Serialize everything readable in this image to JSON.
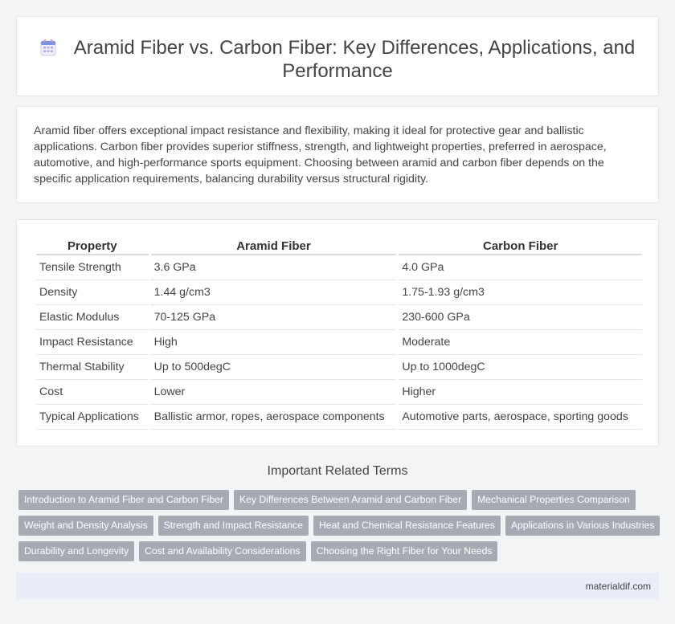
{
  "header": {
    "title": "Aramid Fiber vs. Carbon Fiber: Key Differences, Applications, and Performance",
    "icon": "calendar-icon"
  },
  "intro": {
    "text": "Aramid fiber offers exceptional impact resistance and flexibility, making it ideal for protective gear and ballistic applications. Carbon fiber provides superior stiffness, strength, and lightweight properties, preferred in aerospace, automotive, and high-performance sports equipment. Choosing between aramid and carbon fiber depends on the specific application requirements, balancing durability versus structural rigidity."
  },
  "table": {
    "headers": [
      "Property",
      "Aramid Fiber",
      "Carbon Fiber"
    ],
    "rows": [
      [
        "Tensile Strength",
        "3.6 GPa",
        "4.0 GPa"
      ],
      [
        "Density",
        "1.44 g/cm3",
        "1.75-1.93 g/cm3"
      ],
      [
        "Elastic Modulus",
        "70-125 GPa",
        "230-600 GPa"
      ],
      [
        "Impact Resistance",
        "High",
        "Moderate"
      ],
      [
        "Thermal Stability",
        "Up to 500degC",
        "Up to 1000degC"
      ],
      [
        "Cost",
        "Lower",
        "Higher"
      ],
      [
        "Typical Applications",
        "Ballistic armor, ropes, aerospace components",
        "Automotive parts, aerospace, sporting goods"
      ]
    ]
  },
  "related": {
    "title": "Important Related Terms",
    "rows": [
      [
        "Introduction to Aramid Fiber and Carbon Fiber",
        "Key Differences Between Aramid and Carbon Fiber",
        "Mechanical Properties Comparison"
      ],
      [
        "Weight and Density Analysis",
        "Strength and Impact Resistance",
        "Heat and Chemical Resistance Features",
        "Applications in Various Industries"
      ],
      [
        "Durability and Longevity",
        "Cost and Availability Considerations",
        "Choosing the Right Fiber for Your Needs"
      ]
    ]
  },
  "footer": {
    "site": "materialdif.com"
  },
  "colors": {
    "tag_bg": "#a6aab3",
    "footer_bg": "#e8edf7",
    "icon_accent": "#6b8fd6"
  }
}
